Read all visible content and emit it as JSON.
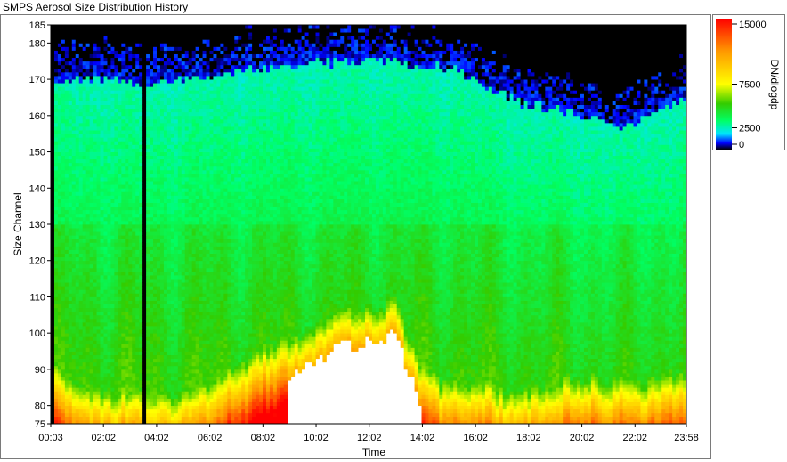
{
  "window": {
    "title": "SMPS Aerosol Size Distribution History"
  },
  "chart_data": {
    "type": "heatmap",
    "title": "SMPS Aerosol Size Distribution History",
    "xlabel": "Time",
    "ylabel": "Size Channel",
    "x_tick_labels": [
      "00:03",
      "02:02",
      "04:02",
      "06:02",
      "08:02",
      "10:02",
      "12:02",
      "14:02",
      "16:02",
      "18:02",
      "20:02",
      "22:02",
      "23:58"
    ],
    "y_tick_labels": [
      "185",
      "180",
      "170",
      "160",
      "150",
      "140",
      "130",
      "120",
      "110",
      "100",
      "90",
      "80",
      "75"
    ],
    "ylim": [
      75,
      185
    ],
    "xlim": [
      "00:03",
      "23:58"
    ],
    "colorbar": {
      "label": "DN/dlogdp",
      "tick_labels": [
        "15000",
        "7500",
        "2500",
        "0"
      ],
      "ticks": [
        15000,
        7500,
        2500,
        0
      ],
      "range": [
        0,
        15000
      ]
    },
    "colormap": [
      "#000000",
      "#0000ff",
      "#00e5ff",
      "#00ff66",
      "#33cc00",
      "#ffff00",
      "#ff9900",
      "#ff0000"
    ],
    "missing_data_times": [
      "00:10",
      "03:35"
    ],
    "profile": {
      "description_keys": [
        "time_hours",
        "upper_edge_channel",
        "dense_zone_top_channel"
      ],
      "time_hours": [
        0.05,
        1,
        2,
        3,
        4,
        5,
        6,
        7,
        8,
        9,
        10,
        11,
        12,
        13,
        14,
        15,
        16,
        17,
        18,
        19,
        20,
        21,
        22,
        23,
        23.97
      ],
      "upper_edge_channel": [
        168,
        170,
        170,
        169,
        169,
        170,
        171,
        172,
        173,
        174,
        174,
        175,
        175,
        175,
        174,
        173,
        170,
        166,
        163,
        162,
        160,
        158,
        157,
        161,
        165
      ],
      "dense_zone_top_channel": [
        82,
        78,
        76,
        75,
        75,
        76,
        78,
        84,
        87,
        90,
        94,
        98,
        100,
        101,
        82,
        78,
        79,
        76,
        76,
        78,
        80,
        80,
        78,
        80,
        82
      ]
    }
  }
}
